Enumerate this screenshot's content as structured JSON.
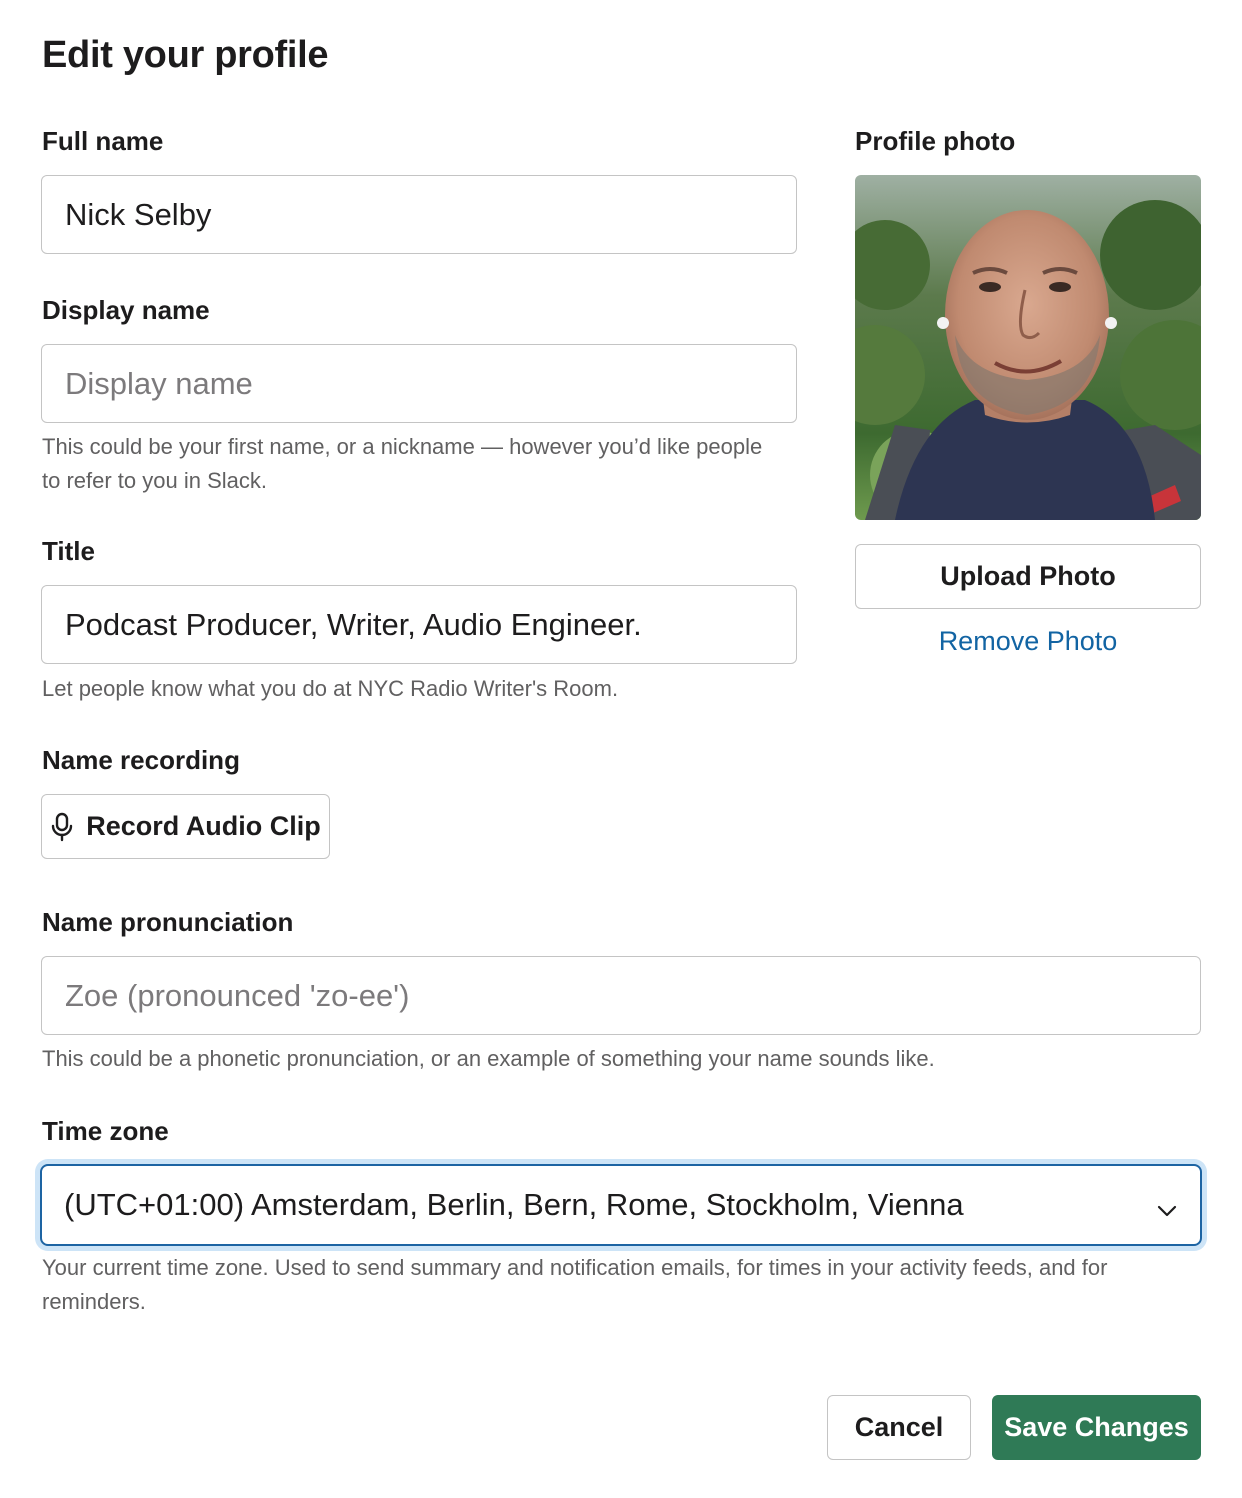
{
  "page": {
    "title": "Edit your profile"
  },
  "full_name": {
    "label": "Full name",
    "value": "Nick Selby"
  },
  "display_name": {
    "label": "Display name",
    "placeholder": "Display name",
    "hint_line1": "This could be your first name, or a nickname — however you’d like people",
    "hint_line2": "to refer to you in Slack."
  },
  "title_field": {
    "label": "Title",
    "value": "Podcast Producer, Writer, Audio Engineer.",
    "hint": "Let people know what you do at NYC Radio Writer's Room."
  },
  "name_recording": {
    "label": "Name recording",
    "button_label": "Record Audio Clip",
    "icon": "microphone-icon"
  },
  "name_pronunciation": {
    "label": "Name pronunciation",
    "placeholder": "Zoe (pronounced 'zo-ee')",
    "hint": "This could be a phonetic pronunciation, or an example of something your name sounds like."
  },
  "time_zone": {
    "label": "Time zone",
    "selected": "(UTC+01:00) Amsterdam, Berlin, Bern, Rome, Stockholm, Vienna",
    "hint_line1": "Your current time zone. Used to send summary and notification emails, for times in your activity feeds, and for",
    "hint_line2": "reminders.",
    "icon": "chevron-down-icon"
  },
  "profile_photo": {
    "label": "Profile photo",
    "upload_label": "Upload Photo",
    "remove_label": "Remove Photo"
  },
  "actions": {
    "cancel_label": "Cancel",
    "save_label": "Save Changes"
  },
  "colors": {
    "accent_link": "#1264a3",
    "save_button": "#2f7a56",
    "focus_border": "#1d64a3",
    "focus_ring": "#cde4f7"
  }
}
